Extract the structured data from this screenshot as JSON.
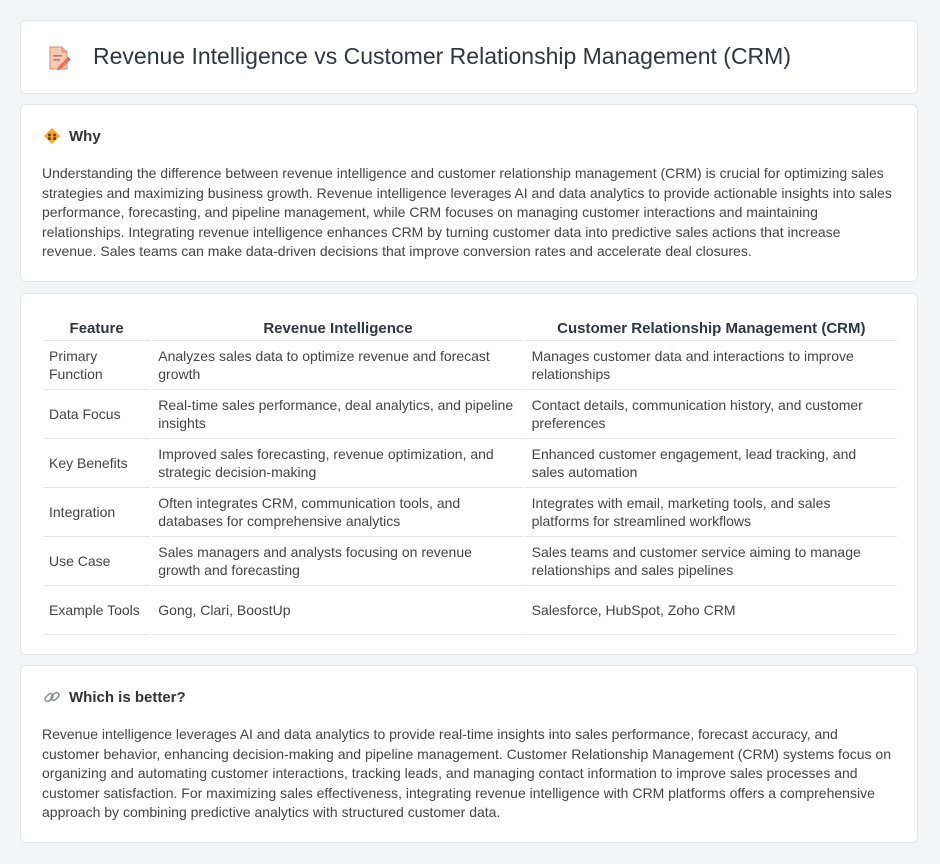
{
  "page": {
    "title": "Revenue Intelligence vs Customer Relationship Management (CRM)",
    "icon": "document-pencil-icon"
  },
  "why": {
    "heading": "Why",
    "icon": "diamond-people-icon",
    "text": "Understanding the difference between revenue intelligence and customer relationship management (CRM) is crucial for optimizing sales strategies and maximizing business growth. Revenue intelligence leverages AI and data analytics to provide actionable insights into sales performance, forecasting, and pipeline management, while CRM focuses on managing customer interactions and maintaining relationships. Integrating revenue intelligence enhances CRM by turning customer data into predictive sales actions that increase revenue. Sales teams can make data-driven decisions that improve conversion rates and accelerate deal closures."
  },
  "table": {
    "headers": [
      "Feature",
      "Revenue Intelligence",
      "Customer Relationship Management (CRM)"
    ],
    "rows": [
      [
        "Primary Function",
        "Analyzes sales data to optimize revenue and forecast growth",
        "Manages customer data and interactions to improve relationships"
      ],
      [
        "Data Focus",
        "Real-time sales performance, deal analytics, and pipeline insights",
        "Contact details, communication history, and customer preferences"
      ],
      [
        "Key Benefits",
        "Improved sales forecasting, revenue optimization, and strategic decision-making",
        "Enhanced customer engagement, lead tracking, and sales automation"
      ],
      [
        "Integration",
        "Often integrates CRM, communication tools, and databases for comprehensive analytics",
        "Integrates with email, marketing tools, and sales platforms for streamlined workflows"
      ],
      [
        "Use Case",
        "Sales managers and analysts focusing on revenue growth and forecasting",
        "Sales teams and customer service aiming to manage relationships and sales pipelines"
      ],
      [
        "Example Tools",
        "Gong, Clari, BoostUp",
        "Salesforce, HubSpot, Zoho CRM"
      ]
    ]
  },
  "better": {
    "heading": "Which is better?",
    "icon": "link-icon",
    "text": "Revenue intelligence leverages AI and data analytics to provide real-time insights into sales performance, forecast accuracy, and customer behavior, enhancing decision-making and pipeline management. Customer Relationship Management (CRM) systems focus on organizing and automating customer interactions, tracking leads, and managing contact information to improve sales processes and customer satisfaction. For maximizing sales effectiveness, integrating revenue intelligence with CRM platforms offers a comprehensive approach by combining predictive analytics with structured customer data."
  }
}
